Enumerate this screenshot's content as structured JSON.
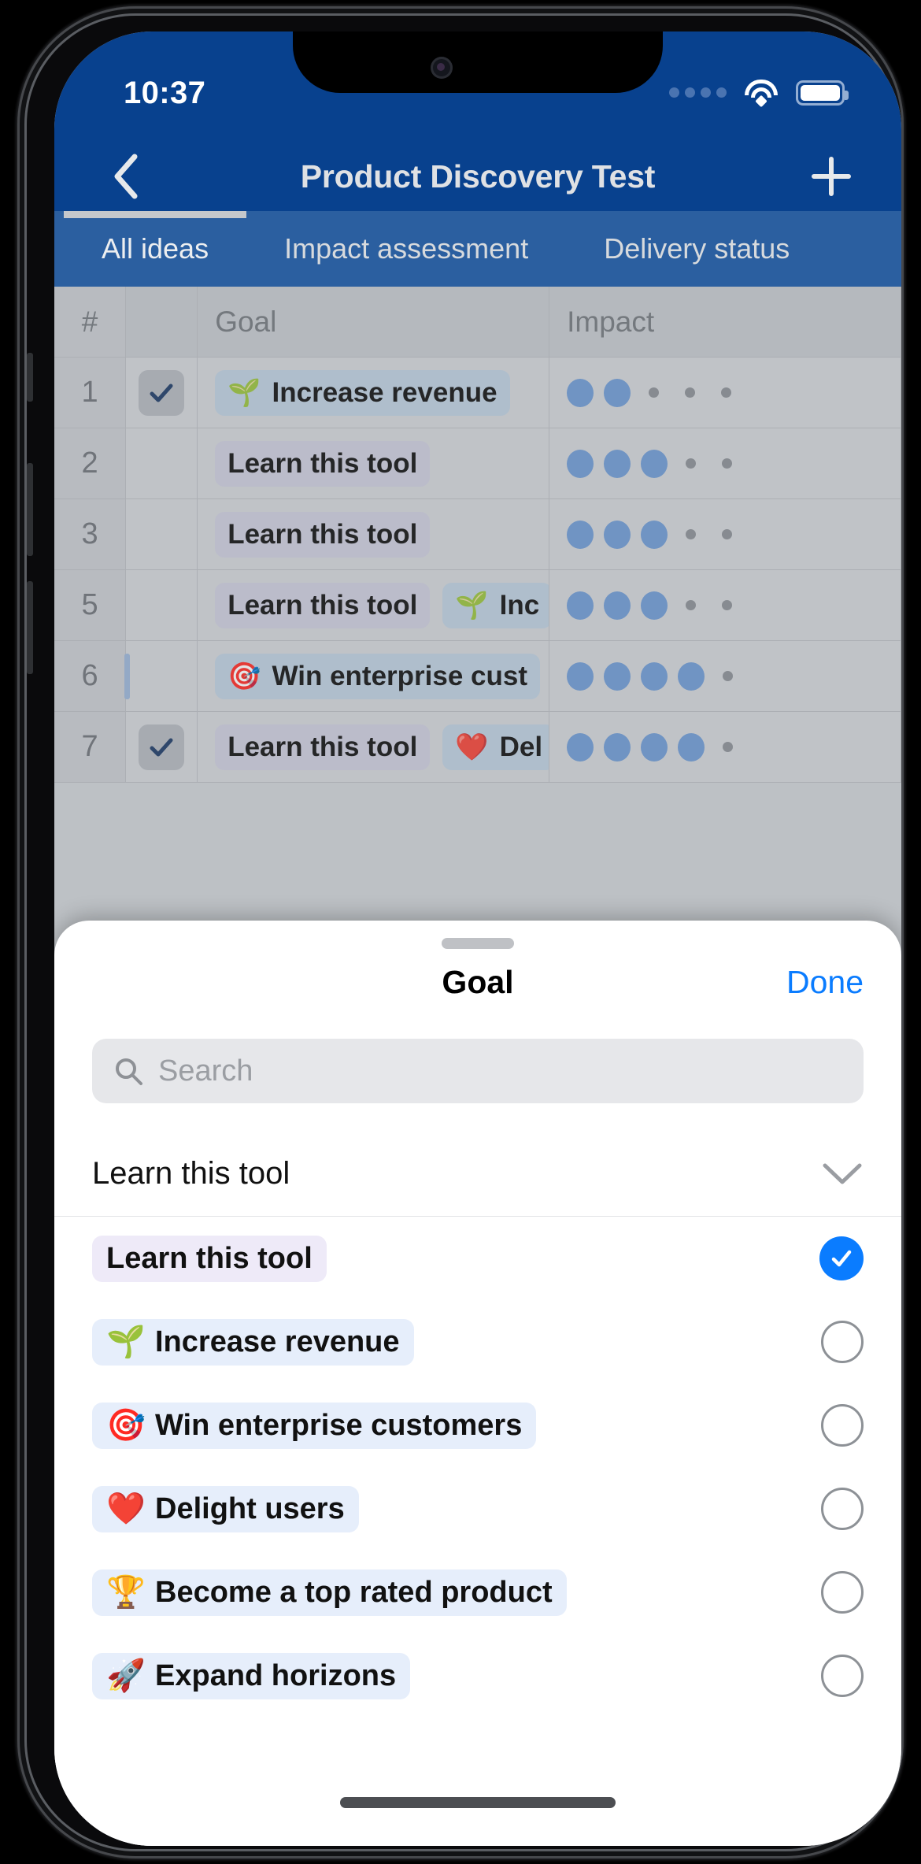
{
  "status_bar": {
    "time": "10:37",
    "cellular_icon": "cellular-dots-icon",
    "wifi_icon": "wifi-icon",
    "battery_icon": "battery-full-icon"
  },
  "nav_bar": {
    "back_icon": "chevron-left-icon",
    "title": "Product Discovery Test",
    "add_icon": "plus-icon"
  },
  "tabs": [
    {
      "label": "All ideas",
      "active": true
    },
    {
      "label": "Impact assessment",
      "active": false
    },
    {
      "label": "Delivery status",
      "active": false
    }
  ],
  "table": {
    "columns": [
      "#",
      "",
      "Goal",
      "Impact"
    ],
    "impact_max": 5,
    "rows": [
      {
        "num": "1",
        "checked": true,
        "sliver": false,
        "goals": [
          {
            "emoji": "🌱",
            "label": "Increase revenue",
            "style": "blu"
          }
        ],
        "impact": 2
      },
      {
        "num": "2",
        "checked": false,
        "sliver": false,
        "goals": [
          {
            "emoji": "",
            "label": "Learn this tool",
            "style": "lav"
          }
        ],
        "impact": 3
      },
      {
        "num": "3",
        "checked": false,
        "sliver": false,
        "goals": [
          {
            "emoji": "",
            "label": "Learn this tool",
            "style": "lav"
          }
        ],
        "impact": 3
      },
      {
        "num": "5",
        "checked": false,
        "sliver": false,
        "goals": [
          {
            "emoji": "",
            "label": "Learn this tool",
            "style": "lav"
          },
          {
            "emoji": "🌱",
            "label": "Inc",
            "style": "blu"
          }
        ],
        "impact": 3
      },
      {
        "num": "6",
        "checked": false,
        "sliver": true,
        "goals": [
          {
            "emoji": "🎯",
            "label": "Win enterprise cust",
            "style": "blu"
          }
        ],
        "impact": 4
      },
      {
        "num": "7",
        "checked": true,
        "sliver": false,
        "goals": [
          {
            "emoji": "",
            "label": "Learn this tool",
            "style": "lav"
          },
          {
            "emoji": "❤️",
            "label": "Del",
            "style": "blu"
          }
        ],
        "impact": 4
      }
    ]
  },
  "sheet": {
    "title": "Goal",
    "done_label": "Done",
    "search": {
      "value": "",
      "placeholder": "Search",
      "icon": "search-icon"
    },
    "selected": {
      "label": "Learn this tool",
      "chevron_icon": "chevron-down-icon"
    },
    "options": [
      {
        "emoji": "",
        "label": "Learn this tool",
        "style": "lav",
        "selected": true
      },
      {
        "emoji": "🌱",
        "label": "Increase revenue",
        "style": "blu",
        "selected": false
      },
      {
        "emoji": "🎯",
        "label": "Win enterprise customers",
        "style": "blu",
        "selected": false
      },
      {
        "emoji": "❤️",
        "label": "Delight users",
        "style": "blu",
        "selected": false
      },
      {
        "emoji": "🏆",
        "label": "Become a top rated product",
        "style": "blu",
        "selected": false
      },
      {
        "emoji": "🚀",
        "label": "Expand horizons",
        "style": "blu",
        "selected": false
      }
    ]
  },
  "colors": {
    "nav_blue": "#08418e",
    "tab_blue": "#2b5fa0",
    "accent_blue": "#0a7cff",
    "impact_dot": "#6e9ad4",
    "chip_lavender": "#eeeaf8",
    "chip_blue": "#e6eefb"
  }
}
